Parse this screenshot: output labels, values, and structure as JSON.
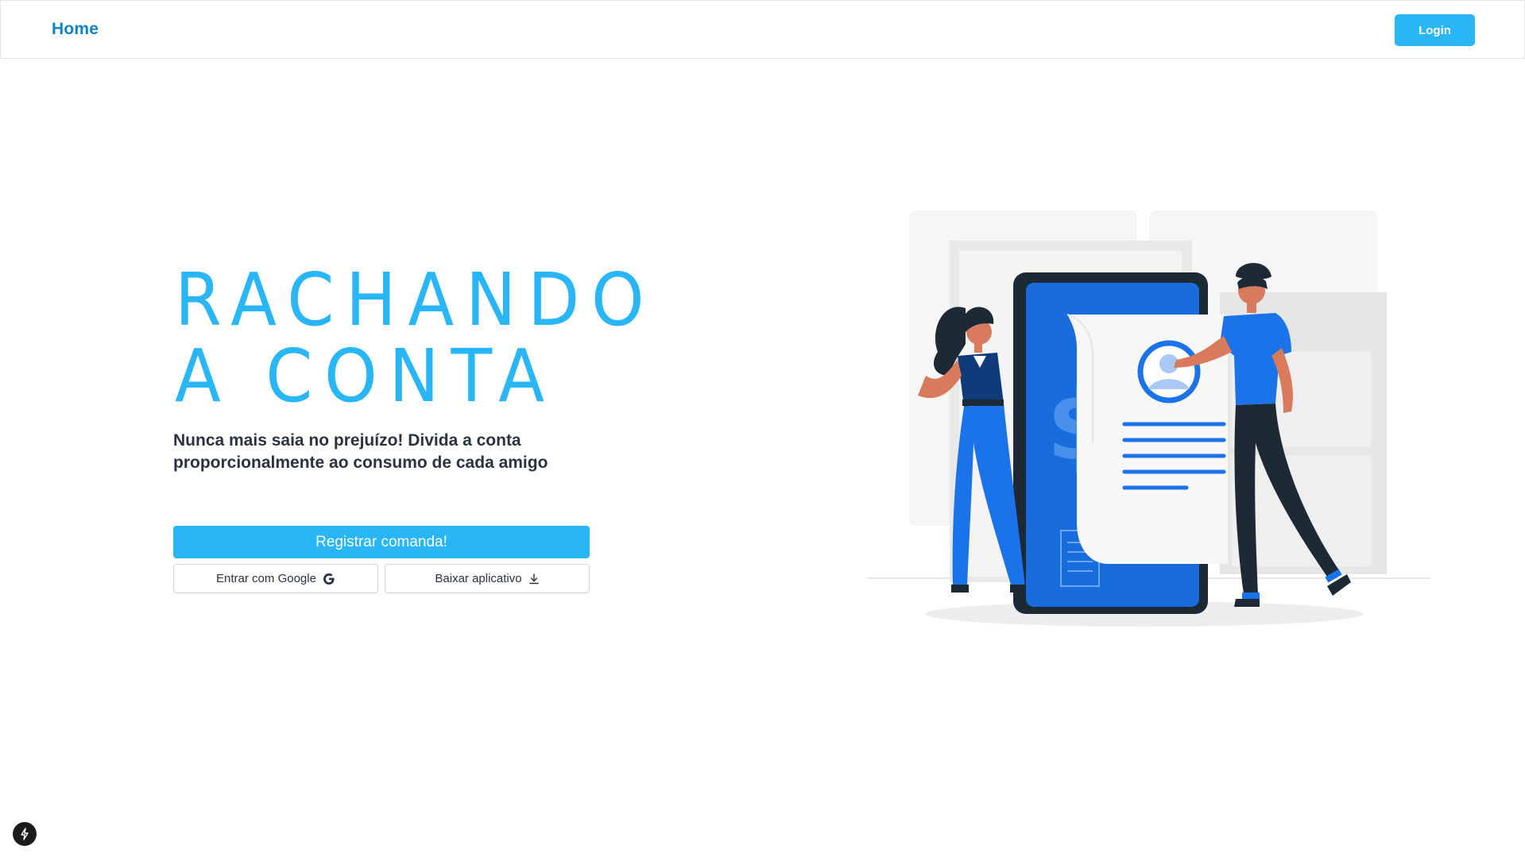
{
  "header": {
    "home_label": "Home",
    "login_label": "Login"
  },
  "hero": {
    "title_line1": "RACHANDO",
    "title_line2": "A CONTA",
    "subtitle": "Nunca mais saia no prejuízo! Divida a conta proporcionalmente ao consumo de cada amigo",
    "register_label": "Registrar comanda!",
    "google_label": "Entrar com Google",
    "download_label": "Baixar aplicativo"
  },
  "illustration": {
    "currency_symbol": "$"
  },
  "icons": {
    "google": "google-g-icon",
    "download": "download-arrow-icon",
    "badge": "lightning-bolt-icon"
  },
  "colors": {
    "accent": "#29b6f6",
    "brand_dark": "#0d84c9",
    "phone_blue": "#1a73e8",
    "text_dark": "#2b3340"
  }
}
